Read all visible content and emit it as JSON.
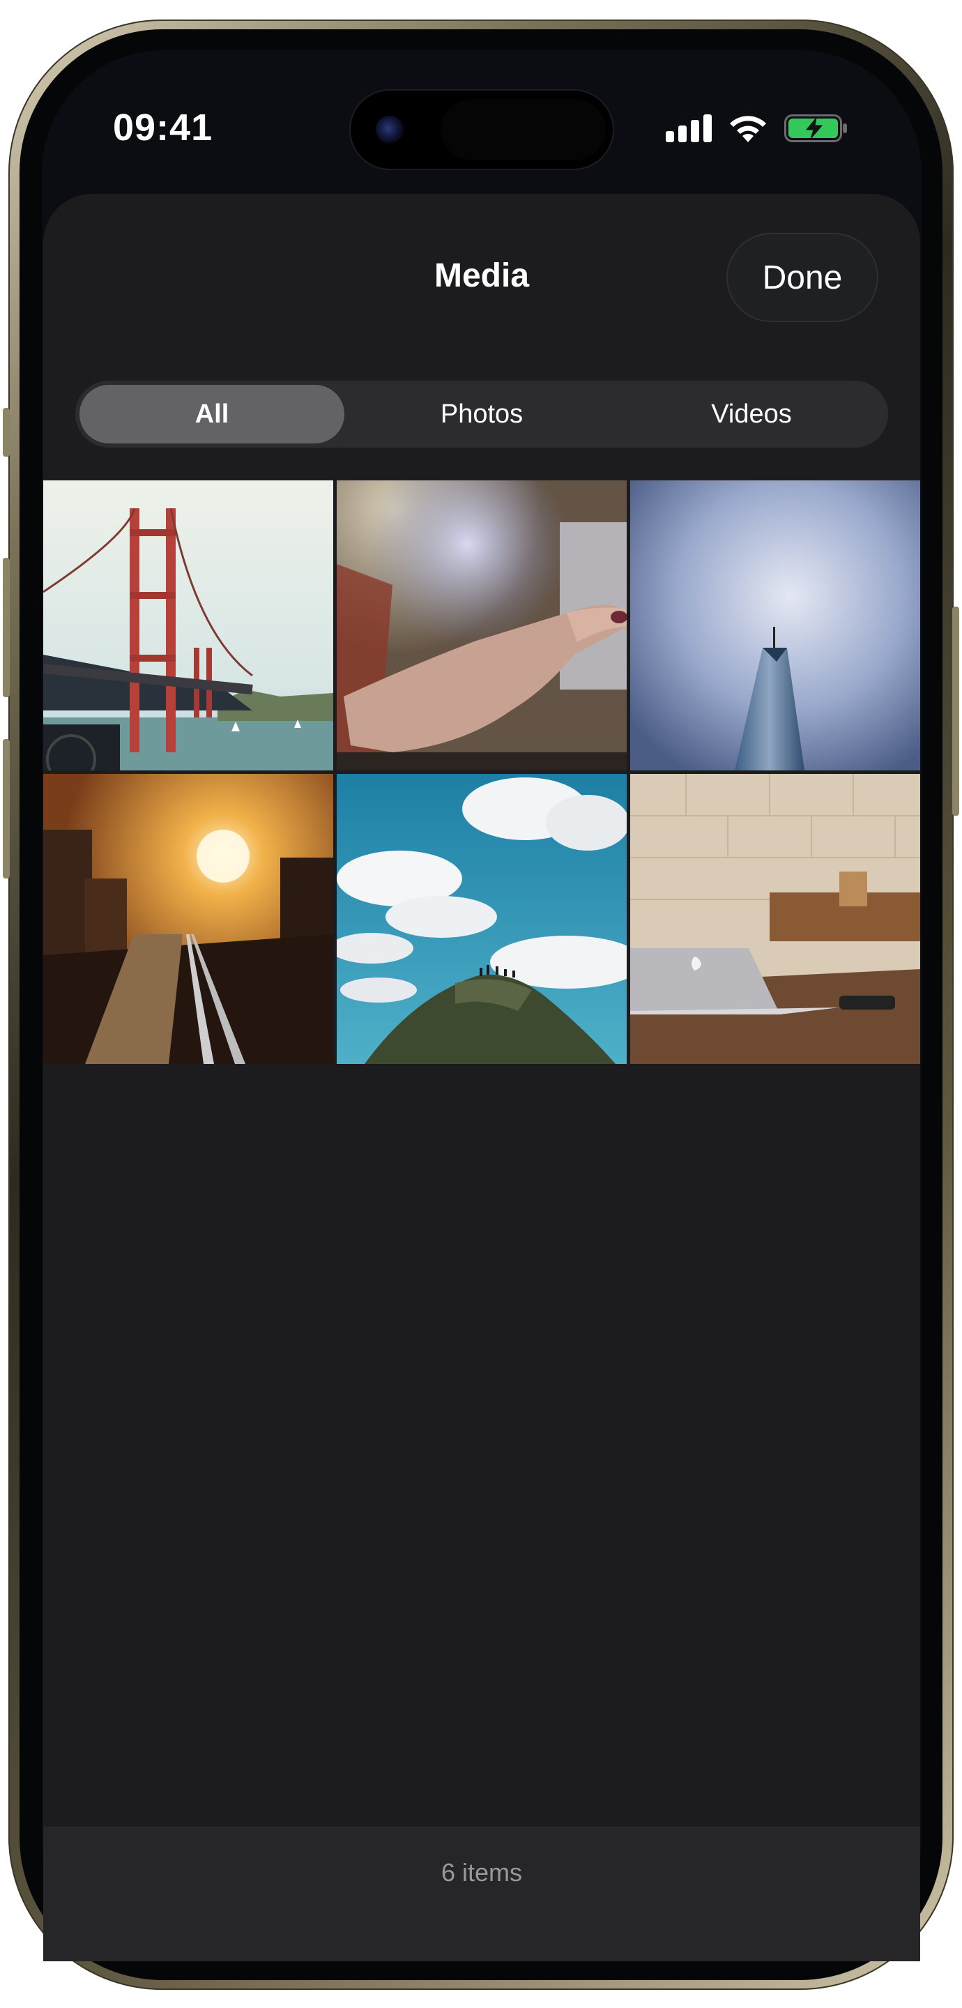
{
  "status_bar": {
    "time": "09:41",
    "icons": [
      "cellular-signal-icon",
      "wifi-icon",
      "battery-charging-icon"
    ],
    "battery_color": "#34c759"
  },
  "sheet": {
    "title": "Media",
    "done_label": "Done"
  },
  "filter": {
    "options": [
      {
        "label": "All",
        "selected": true
      },
      {
        "label": "Photos",
        "selected": false
      },
      {
        "label": "Videos",
        "selected": false
      }
    ]
  },
  "media": {
    "items": [
      {
        "subject": "golden-gate-bridge"
      },
      {
        "subject": "finger-touching-screen"
      },
      {
        "subject": "skyscraper-sky"
      },
      {
        "subject": "train-tracks-sunset"
      },
      {
        "subject": "clouds-rocky-hill"
      },
      {
        "subject": "laptop-on-desk"
      }
    ]
  },
  "footer": {
    "count_label": "6 items"
  },
  "colors": {
    "sheet_background": "#1c1c1e",
    "segment_active": "#636366",
    "segment_track": "#2c2c2e",
    "footer_text": "#98989d"
  }
}
